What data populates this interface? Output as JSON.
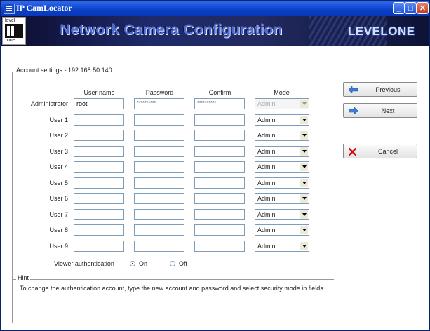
{
  "window": {
    "title": "IP CamLocator"
  },
  "banner": {
    "title": "Network Camera Configuration",
    "brand": "LEVELONE",
    "logo_top": "level",
    "logo_bottom": "one"
  },
  "account": {
    "legend": "Account settings - 192.168.50.140",
    "columns": [
      "User name",
      "Password",
      "Confirm",
      "Mode"
    ],
    "rows": [
      {
        "label": "Administrator",
        "username": "root",
        "password": "**********",
        "confirm": "**********",
        "mode": "Admin",
        "mode_disabled": true
      },
      {
        "label": "User 1",
        "username": "",
        "password": "",
        "confirm": "",
        "mode": "Admin"
      },
      {
        "label": "User 2",
        "username": "",
        "password": "",
        "confirm": "",
        "mode": "Admin"
      },
      {
        "label": "User 3",
        "username": "",
        "password": "",
        "confirm": "",
        "mode": "Admin"
      },
      {
        "label": "User 4",
        "username": "",
        "password": "",
        "confirm": "",
        "mode": "Admin"
      },
      {
        "label": "User 5",
        "username": "",
        "password": "",
        "confirm": "",
        "mode": "Admin"
      },
      {
        "label": "User 6",
        "username": "",
        "password": "",
        "confirm": "",
        "mode": "Admin"
      },
      {
        "label": "User 7",
        "username": "",
        "password": "",
        "confirm": "",
        "mode": "Admin"
      },
      {
        "label": "User 8",
        "username": "",
        "password": "",
        "confirm": "",
        "mode": "Admin"
      },
      {
        "label": "User 9",
        "username": "",
        "password": "",
        "confirm": "",
        "mode": "Admin"
      }
    ],
    "viewer_auth": {
      "label": "Viewer authentication",
      "on_label": "On",
      "off_label": "Off",
      "selected": "On"
    }
  },
  "hint": {
    "title": "Hint",
    "text": "To change the authentication account, type the new account and password and select security mode in fields."
  },
  "buttons": {
    "previous": "Previous",
    "next": "Next",
    "cancel": "Cancel"
  },
  "colors": {
    "titlebar": "#0a3fc8",
    "banner_text": "#4e6ad0",
    "cancel_icon": "#cc1111",
    "arrow_icon": "#3d7fd6"
  },
  "icons": {
    "previous": "arrow-left-icon",
    "next": "arrow-right-icon",
    "cancel": "x-icon"
  }
}
